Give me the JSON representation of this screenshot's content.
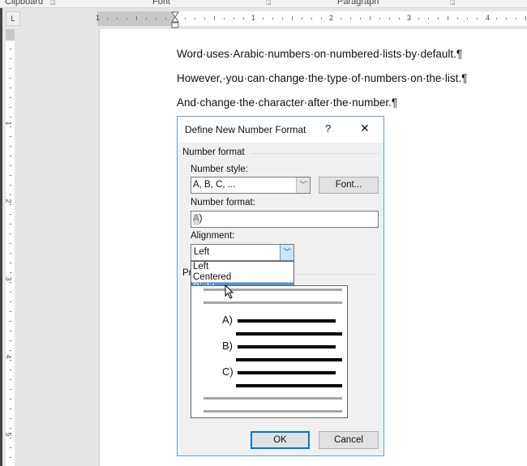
{
  "ribbon": {
    "groups": [
      "Clipboard",
      "Font",
      "Paragraph"
    ]
  },
  "ruler": {
    "tab_selector": "L",
    "h_numbers": [
      "1",
      "1",
      "2",
      "3",
      "4"
    ],
    "v_numbers": [
      "1",
      "2",
      "3",
      "4",
      "5"
    ]
  },
  "document": {
    "paragraphs": [
      "Word·uses·Arabic·numbers·on·numbered·lists·by·default.¶",
      "However,·you·can·change·the·type·of·numbers·on·the·list.¶",
      "And·change·the·character·after·the·number.¶"
    ]
  },
  "dialog": {
    "title": "Define New Number Format",
    "help": "?",
    "close": "✕",
    "group_label": "Number format",
    "number_style_label": "Number style:",
    "number_style_value": "A, B, C, ...",
    "font_button": "Font...",
    "number_format_label": "Number format:",
    "number_format_value": "A)",
    "alignment_label": "Alignment:",
    "alignment_value": "Left",
    "alignment_options": [
      "Left",
      "Centered",
      "Right"
    ],
    "highlighted_option": "Right",
    "preview_label": "Pr",
    "preview_items": [
      "A)",
      "B)",
      "C)"
    ],
    "ok": "OK",
    "cancel": "Cancel"
  },
  "colors": {
    "accent": "#0078d7",
    "highlight": "#3399ff",
    "dialog_border": "#5aa0d8"
  }
}
